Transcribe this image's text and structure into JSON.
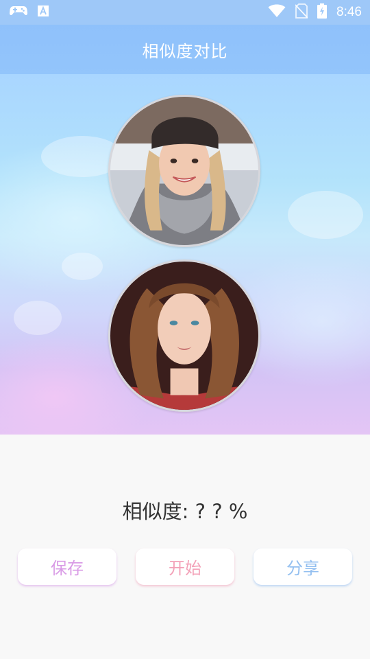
{
  "status_bar": {
    "time": "8:46",
    "icons": [
      "gamepad-icon",
      "font-a-icon",
      "wifi-icon",
      "no-sim-icon",
      "battery-charging-icon"
    ]
  },
  "app_bar": {
    "title": "相似度对比"
  },
  "photos": [
    {
      "name": "first-face-photo",
      "description_icon": "woman-beanie-photo"
    },
    {
      "name": "second-face-photo",
      "description_icon": "woman-curly-hair-photo"
    }
  ],
  "result": {
    "text": "相似度: ? ? %"
  },
  "actions": {
    "save_label": "保存",
    "start_label": "开始",
    "share_label": "分享"
  },
  "colors": {
    "app_bar": "#8fc1fb",
    "save": "#d99be6",
    "start": "#f3a1b8",
    "share": "#93bff0"
  }
}
